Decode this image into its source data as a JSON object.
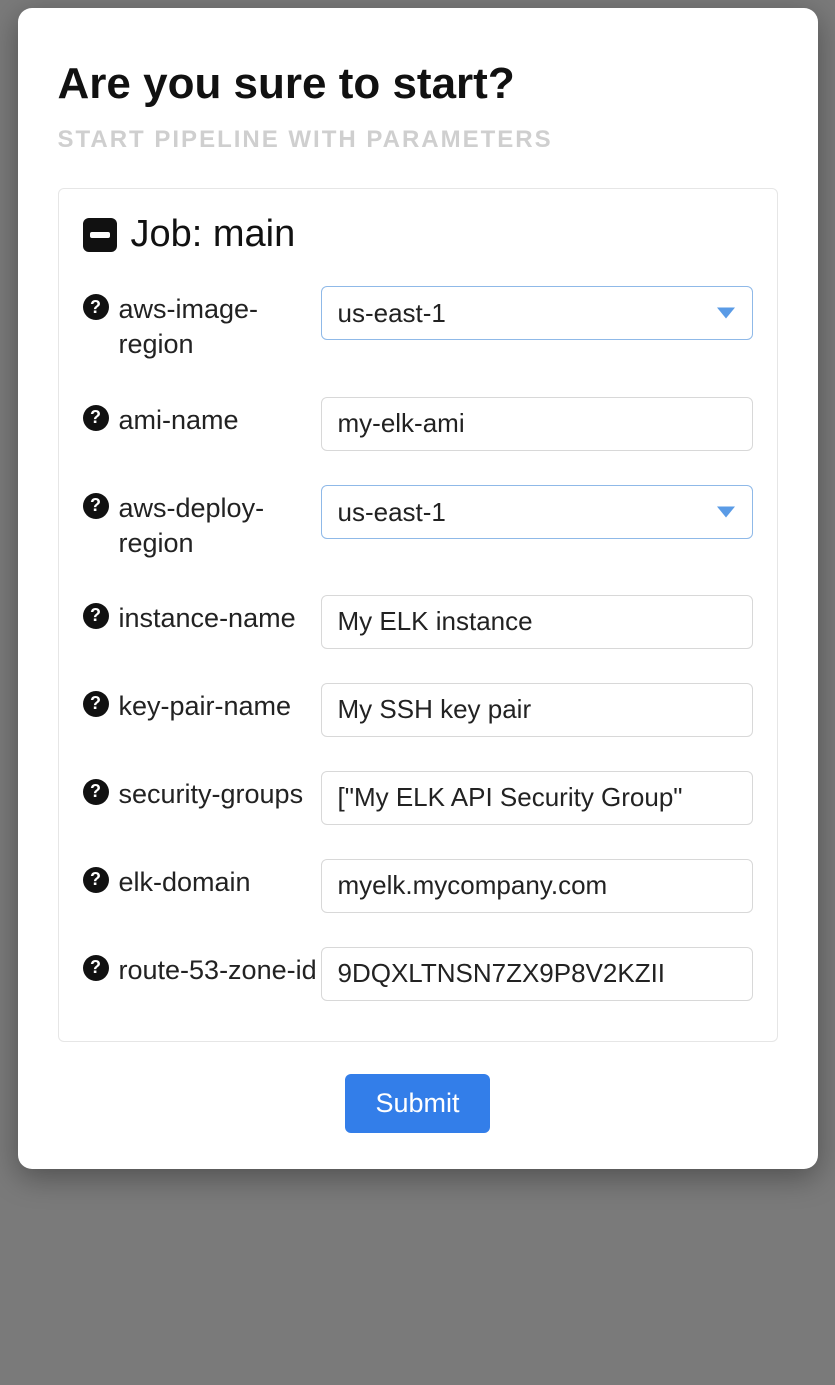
{
  "modal": {
    "title": "Are you sure to start?",
    "subtitle": "START PIPELINE WITH PARAMETERS",
    "panel_title": "Job: main",
    "submit_label": "Submit"
  },
  "fields": {
    "aws_image_region": {
      "label": "aws-image-region",
      "value": "us-east-1"
    },
    "ami_name": {
      "label": "ami-name",
      "value": "my-elk-ami"
    },
    "aws_deploy_region": {
      "label": "aws-deploy-region",
      "value": "us-east-1"
    },
    "instance_name": {
      "label": "instance-name",
      "value": "My ELK instance"
    },
    "key_pair_name": {
      "label": "key-pair-name",
      "value": "My SSH key pair"
    },
    "security_groups": {
      "label": "security-groups",
      "value": "[\"My ELK API Security Group\""
    },
    "elk_domain": {
      "label": "elk-domain",
      "value": "myelk.mycompany.com"
    },
    "route53_zone_id": {
      "label": "route-53-zone-id",
      "value": "9DQXLTNSN7ZX9P8V2KZII"
    }
  }
}
